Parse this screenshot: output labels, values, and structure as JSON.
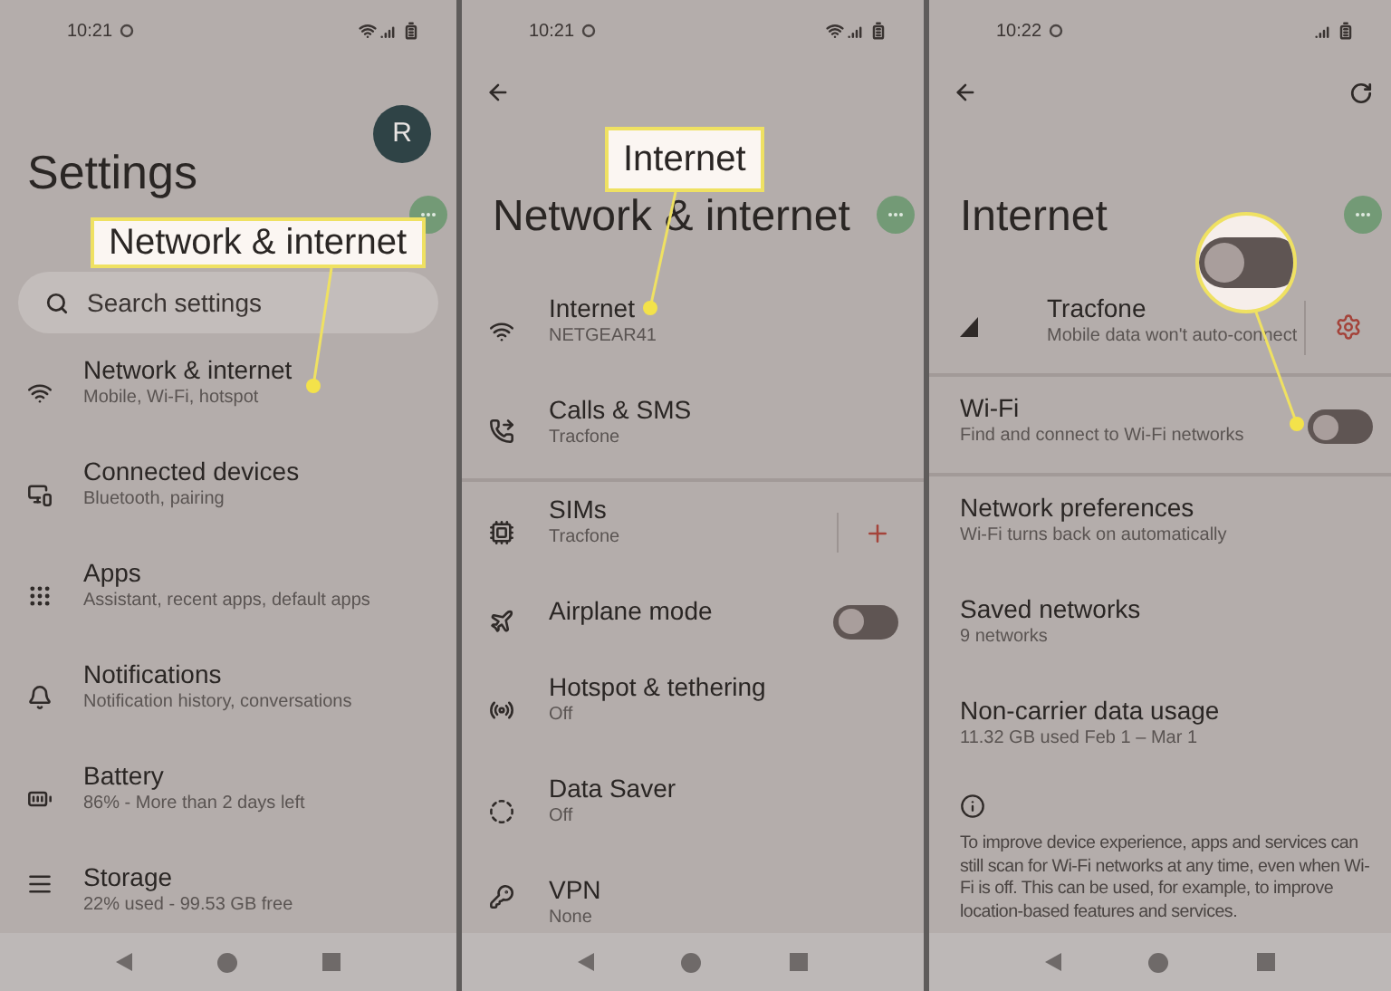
{
  "panels": [
    {
      "kind": "settings",
      "status": {
        "time": "10:21",
        "wifi": true
      },
      "avatar": "R",
      "title": "Settings",
      "search": {
        "placeholder": "Search settings"
      },
      "items": [
        {
          "kind": "plain",
          "title": "Network & internet",
          "subtitle": "Mobile, Wi-Fi, hotspot",
          "divider_after": false
        },
        {
          "kind": "plain",
          "title": "Connected devices",
          "subtitle": "Bluetooth, pairing",
          "divider_after": false
        },
        {
          "kind": "plain",
          "title": "Apps",
          "subtitle": "Assistant, recent apps, default apps",
          "divider_after": false
        },
        {
          "kind": "plain",
          "title": "Notifications",
          "subtitle": "Notification history, conversations",
          "divider_after": false
        },
        {
          "kind": "plain",
          "title": "Battery",
          "subtitle": "86% - More than 2 days left",
          "divider_after": false
        },
        {
          "kind": "plain",
          "title": "Storage",
          "subtitle": "22% used - 99.53 GB free",
          "divider_after": false
        }
      ],
      "callout": {
        "kind": "label",
        "text": "Network & internet"
      }
    },
    {
      "kind": "subpage",
      "status": {
        "time": "10:21",
        "wifi": true
      },
      "title": "Network & internet",
      "items": [
        {
          "kind": "plain",
          "title": "Internet",
          "subtitle": "NETGEAR41",
          "divider_after": false
        },
        {
          "kind": "plain",
          "title": "Calls & SMS",
          "subtitle": "Tracfone",
          "divider_after": true
        },
        {
          "kind": "add",
          "title": "SIMs",
          "subtitle": "Tracfone",
          "divider_after": false
        },
        {
          "kind": "toggle",
          "title": "Airplane mode",
          "on": false,
          "divider_after": false
        },
        {
          "kind": "plain",
          "title": "Hotspot & tethering",
          "subtitle": "Off",
          "divider_after": false
        },
        {
          "kind": "plain",
          "title": "Data Saver",
          "subtitle": "Off",
          "divider_after": false
        },
        {
          "kind": "plain",
          "title": "VPN",
          "subtitle": "None",
          "divider_after": false
        }
      ],
      "callout": {
        "kind": "label",
        "text": "Internet"
      }
    },
    {
      "kind": "subpage",
      "status": {
        "time": "10:22",
        "wifi": false
      },
      "title": "Internet",
      "items": [
        {
          "kind": "settings",
          "title": "Tracfone",
          "subtitle": "Mobile data won't auto-connect",
          "divider_after": true
        },
        {
          "kind": "toggle",
          "title": "Wi-Fi",
          "subtitle": "Find and connect to Wi-Fi networks",
          "on": false,
          "divider_after": true
        },
        {
          "kind": "plain",
          "title": "Network preferences",
          "subtitle": "Wi-Fi turns back on automatically",
          "divider_after": false
        },
        {
          "kind": "plain",
          "title": "Saved networks",
          "subtitle": "9 networks",
          "divider_after": false
        },
        {
          "kind": "plain",
          "title": "Non-carrier data usage",
          "subtitle": "11.32 GB used Feb 1 – Mar 1",
          "divider_after": false
        }
      ],
      "note": "To improve device experience, apps and services can still scan for Wi-Fi networks at any time, even when Wi-Fi is off. This can be used, for example, to improve location-based features and services.",
      "callout": {
        "kind": "magnifier",
        "on": false
      }
    }
  ]
}
